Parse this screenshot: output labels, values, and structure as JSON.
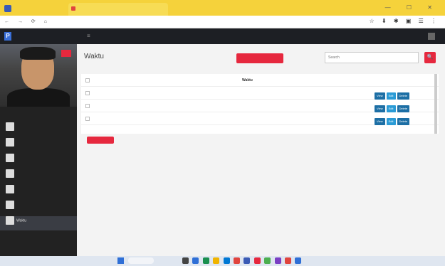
{
  "browser": {
    "tab_inactive": "",
    "tab_active": "",
    "url": "",
    "window_controls": "—  ☐  ✕",
    "nav": "← → ⟳ ⌂"
  },
  "app": {
    "brand": "",
    "brand_logo": "P",
    "user_menu": ""
  },
  "sidebar": {
    "user_name": "",
    "badge": "",
    "items": [
      {
        "label": ""
      },
      {
        "label": ""
      },
      {
        "label": ""
      },
      {
        "label": ""
      },
      {
        "label": ""
      },
      {
        "label": ""
      },
      {
        "label": "Waktu"
      },
      {
        "label": ""
      },
      {
        "label": ""
      }
    ]
  },
  "main": {
    "title": "Waktu",
    "add_button": "",
    "search_placeholder": "Search",
    "search_icon": "🔍",
    "table": {
      "headers": [
        "",
        "Waktu"
      ],
      "rows": [
        {
          "no": "",
          "waktu": ""
        },
        {
          "no": "",
          "waktu": ""
        },
        {
          "no": "",
          "waktu": ""
        }
      ],
      "actions": {
        "view": "View",
        "edit": "Edit",
        "delete": "Delete"
      }
    },
    "pager_button": "",
    "pager_info": ""
  },
  "footer": {
    "left": "",
    "right": ""
  },
  "taskbar": {
    "weather": "",
    "search": "",
    "tray": ""
  },
  "colors": {
    "accent": "#e6283e",
    "topbar": "#1d1f24",
    "sidebar": "#222222",
    "chrome_tab": "#f5d23b"
  }
}
